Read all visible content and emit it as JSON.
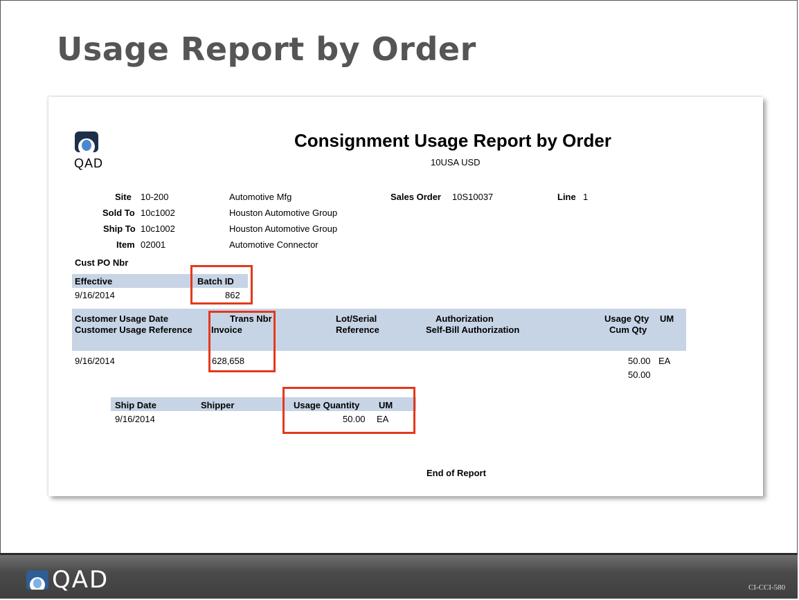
{
  "slide": {
    "title": "Usage Report by Order",
    "footer_logo": "QAD",
    "footer_code": "CI-CCI-580"
  },
  "report": {
    "logo_text": "QAD",
    "title": "Consignment Usage Report by Order",
    "subtitle": "10USA USD",
    "header": {
      "site_label": "Site",
      "site_value": "10-200",
      "site_desc": "Automotive Mfg",
      "sold_to_label": "Sold To",
      "sold_to_value": "10c1002",
      "sold_to_desc": "Houston Automotive Group",
      "ship_to_label": "Ship To",
      "ship_to_value": "10c1002",
      "ship_to_desc": "Houston Automotive Group",
      "item_label": "Item",
      "item_value": "02001",
      "item_desc": "Automotive Connector",
      "cust_po_label": "Cust PO Nbr",
      "sales_order_label": "Sales Order",
      "sales_order_value": "10S10037",
      "line_label": "Line",
      "line_value": "1"
    },
    "batch": {
      "effective_label": "Effective",
      "batch_id_label": "Batch ID",
      "effective_value": "9/16/2014",
      "batch_id_value": "862"
    },
    "usage_table": {
      "col_date_1": "Customer Usage Date",
      "col_date_2": "Customer Usage Reference",
      "col_trans_1": "Trans Nbr",
      "col_trans_2": "Invoice",
      "col_lot_1": "Lot/Serial",
      "col_lot_2": "Reference",
      "col_auth_1": "Authorization",
      "col_auth_2": "Self-Bill Authorization",
      "col_qty_1": "Usage Qty",
      "col_qty_2": "Cum Qty",
      "col_um": "UM",
      "row": {
        "date": "9/16/2014",
        "trans": "628,658",
        "qty": "50.00",
        "um": "EA",
        "cum_qty": "50.00"
      }
    },
    "ship_table": {
      "col_ship_date": "Ship Date",
      "col_shipper": "Shipper",
      "col_usage_qty": "Usage Quantity",
      "col_um": "UM",
      "row": {
        "ship_date": "9/16/2014",
        "usage_qty": "50.00",
        "um": "EA"
      }
    },
    "end_text": "End of Report"
  },
  "colors": {
    "highlight": "#e3391b",
    "band": "#c7d4e5",
    "logo_blue": "#2f5d96"
  }
}
